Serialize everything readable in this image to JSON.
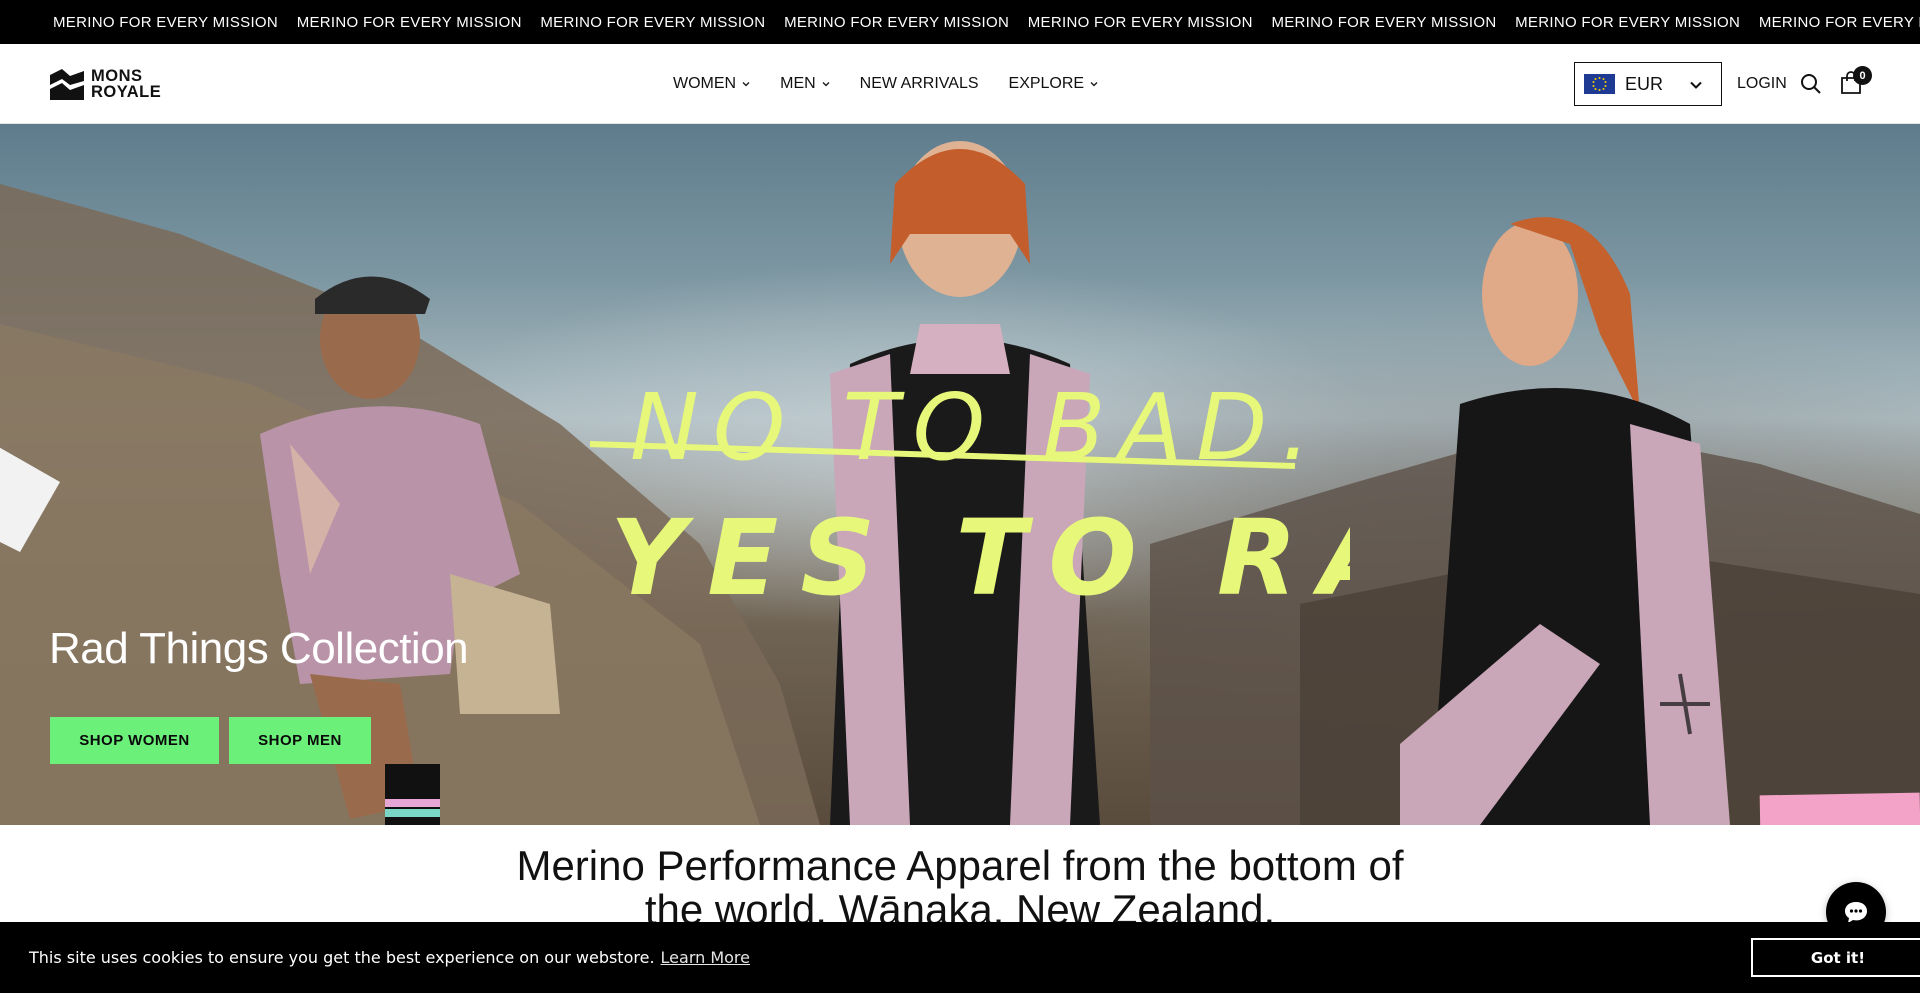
{
  "announcement": {
    "items": [
      "MERINO FOR EVERY MISSION",
      "MERINO FOR EVERY MISSION",
      "MERINO FOR EVERY MISSION",
      "MERINO FOR EVERY MISSION",
      "MERINO FOR EVERY MISSION",
      "MERINO FOR EVERY MISSION",
      "MERINO FOR EVERY MISSION",
      "MERINO FOR EVERY MI"
    ]
  },
  "header": {
    "logo": {
      "line1": "MONS",
      "line2": "ROYALE"
    },
    "nav": [
      {
        "label": "WOMEN",
        "has_dropdown": true
      },
      {
        "label": "MEN",
        "has_dropdown": true
      },
      {
        "label": "NEW ARRIVALS",
        "has_dropdown": false
      },
      {
        "label": "EXPLORE",
        "has_dropdown": true
      }
    ],
    "currency": {
      "selected": "EUR",
      "flag_icon": "eu-flag-icon"
    },
    "login_label": "LOGIN",
    "search_icon": "search-icon",
    "cart_icon": "bag-icon",
    "cart_count": "0"
  },
  "hero": {
    "tagline_struck": "NO TO BAD.",
    "tagline": "YES TO RAD",
    "title": "Rad Things Collection",
    "buttons": {
      "women": "SHOP WOMEN",
      "men": "SHOP MEN"
    },
    "accent_color": "#6bf17a",
    "tagline_color": "#e6f77a"
  },
  "intro": {
    "text": "Merino Performance Apparel from the bottom of the world, Wānaka, New Zealand."
  },
  "cookie": {
    "text": "This site uses cookies to ensure you get the best experience on our webstore.",
    "link": "Learn More",
    "button": "Got it!"
  },
  "chat": {
    "icon": "chat-icon"
  }
}
